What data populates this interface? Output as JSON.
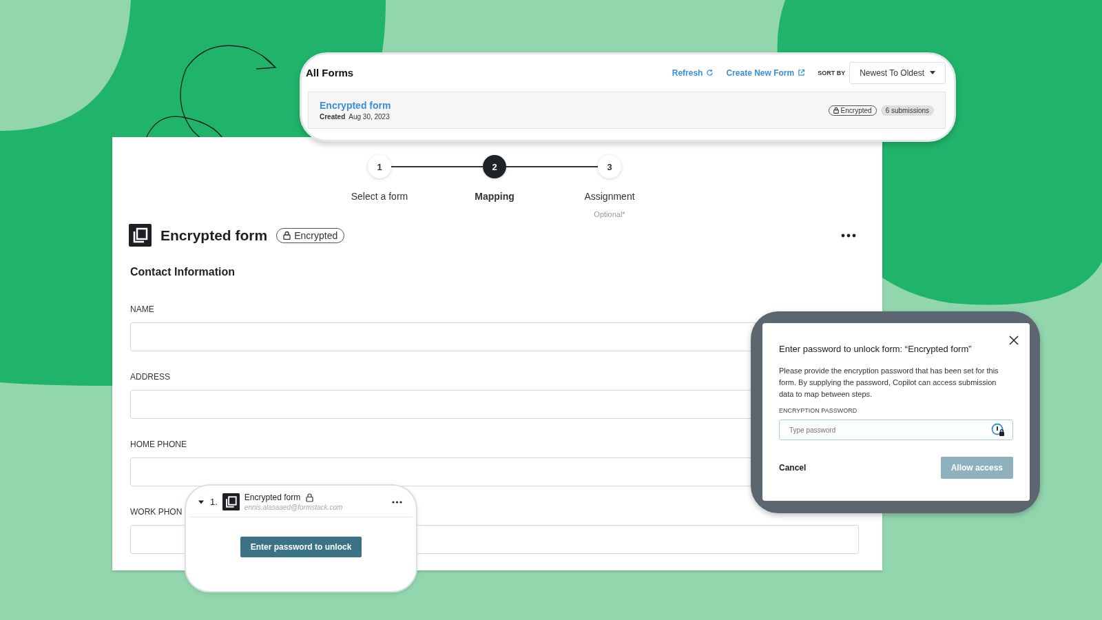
{
  "all_forms_card": {
    "title": "All Forms",
    "refresh": "Refresh",
    "create_new": "Create New Form",
    "sort_label": "SORT BY",
    "sort_value": "Newest To Oldest",
    "form": {
      "name": "Encrypted form",
      "created_label": "Created",
      "created_date": "Aug 30, 2023",
      "badge": "Encrypted",
      "submissions": "6 submissions"
    }
  },
  "stepper": [
    {
      "number": "1",
      "label": "Select a form",
      "selected": false
    },
    {
      "number": "2",
      "label": "Mapping",
      "selected": true
    },
    {
      "number": "3",
      "label": "Assignment",
      "note": "Optional*",
      "selected": false
    }
  ],
  "form_header": {
    "title": "Encrypted form",
    "badge": "Encrypted"
  },
  "section_title": "Contact Information",
  "fields": [
    {
      "label": "NAME"
    },
    {
      "label": "ADDRESS"
    },
    {
      "label": "HOME PHONE"
    },
    {
      "label": "WORK PHON"
    }
  ],
  "form_card": {
    "number": "1.",
    "name": "Encrypted form",
    "email": "ennis.alasaaed@formstack.com",
    "expanded": true,
    "button": "Enter password to unlock"
  },
  "dialog": {
    "title": "Enter password to unlock form: “Encrypted form”",
    "body": "Please provide the encryption password that has been set for this form. By supplying the password, Copilot can access submission data to map between steps.",
    "field_label": "ENCRYPTION PASSWORD",
    "placeholder": "Type password",
    "cancel": "Cancel",
    "confirm": "Allow access",
    "confirm_disabled": true
  }
}
